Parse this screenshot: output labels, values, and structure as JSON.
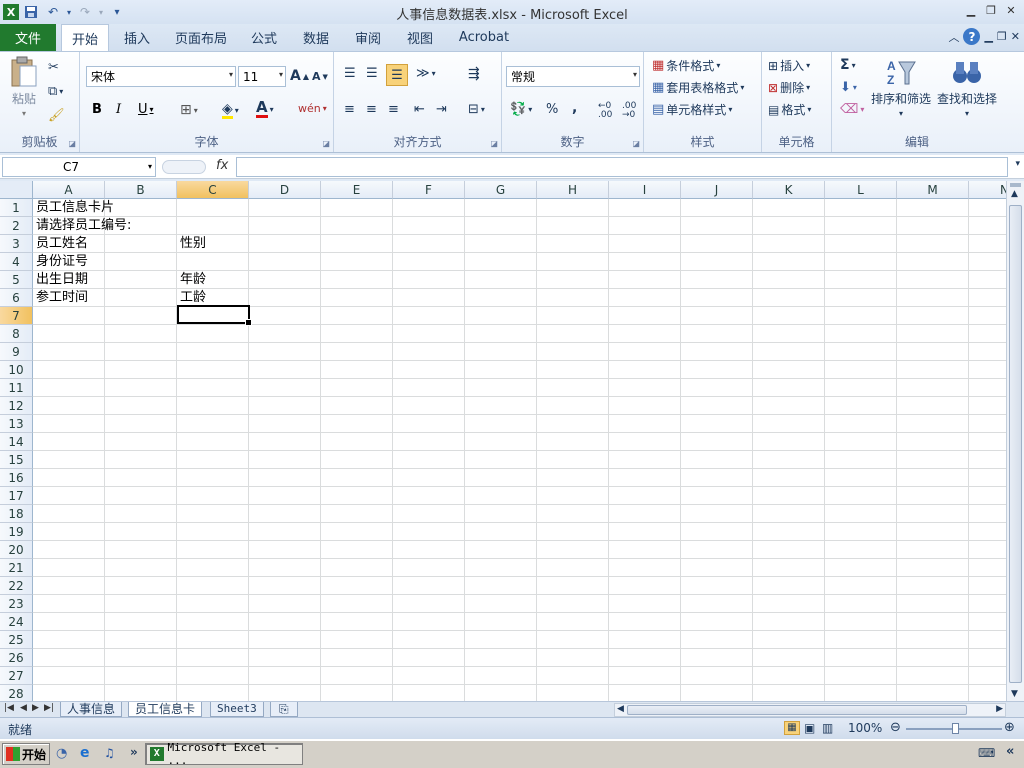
{
  "window": {
    "title": "人事信息数据表.xlsx - Microsoft Excel"
  },
  "tabs": {
    "file": "文件",
    "items": [
      "开始",
      "插入",
      "页面布局",
      "公式",
      "数据",
      "审阅",
      "视图",
      "Acrobat"
    ]
  },
  "ribbon": {
    "clipboard": {
      "label": "剪贴板",
      "paste": "粘贴"
    },
    "font": {
      "label": "字体",
      "name": "宋体",
      "size": "11"
    },
    "alignment": {
      "label": "对齐方式"
    },
    "number": {
      "label": "数字",
      "format": "常规"
    },
    "styles": {
      "label": "样式",
      "conditional": "条件格式",
      "table": "套用表格格式",
      "cell": "单元格样式"
    },
    "cells": {
      "label": "单元格",
      "insert": "插入",
      "delete": "删除",
      "format": "格式"
    },
    "editing": {
      "label": "编辑",
      "sort": "排序和筛选",
      "find": "查找和选择"
    }
  },
  "formula_bar": {
    "name_box": "C7",
    "fx": "fx",
    "value": ""
  },
  "grid": {
    "columns": [
      "A",
      "B",
      "C",
      "D",
      "E",
      "F",
      "G",
      "H",
      "I",
      "J",
      "K",
      "L",
      "M",
      "N"
    ],
    "rows": [
      "1",
      "2",
      "3",
      "4",
      "5",
      "6",
      "7",
      "8",
      "9",
      "10",
      "11",
      "12",
      "13",
      "14",
      "15",
      "16",
      "17",
      "18",
      "19",
      "20",
      "21",
      "22",
      "23",
      "24",
      "25",
      "26",
      "27",
      "28"
    ],
    "cells": {
      "A1": "员工信息卡片",
      "A2": "请选择员工编号:",
      "A3": "员工姓名",
      "C3": "性别",
      "A4": "身份证号",
      "A5": "出生日期",
      "C5": "年龄",
      "A6": "参工时间",
      "C6": "工龄"
    },
    "selected_column": "C",
    "selected_row": "7"
  },
  "sheets": [
    "人事信息",
    "员工信息卡",
    "Sheet3"
  ],
  "status": {
    "text": "就绪",
    "zoom": "100%"
  },
  "taskbar": {
    "start": "开始",
    "excel_task": "Microsoft Excel - ..."
  },
  "colors": {
    "file_tab": "#217a2e",
    "selected_header": "#f1c15f"
  }
}
